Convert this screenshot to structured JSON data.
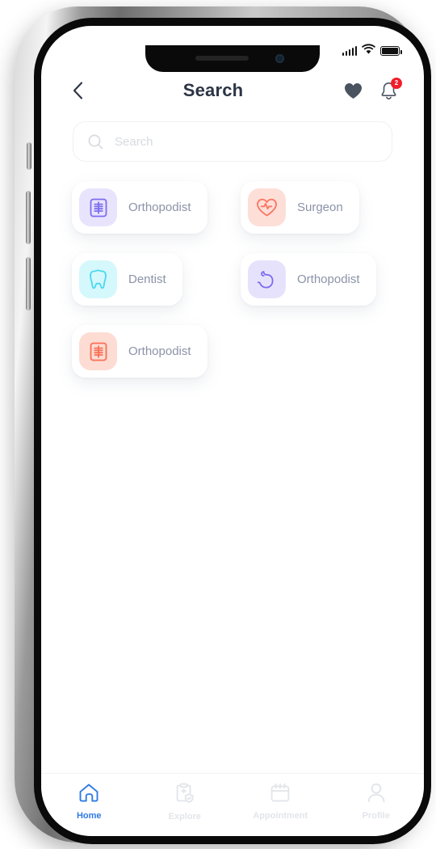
{
  "status_bar": {
    "signal_icon": "cellular-signal-icon",
    "wifi_icon": "wifi-icon",
    "battery_icon": "battery-full-icon"
  },
  "header": {
    "back_icon": "chevron-left-icon",
    "title": "Search",
    "favorite_icon": "heart-filled-icon",
    "notification_icon": "bell-icon",
    "notification_badge": "2"
  },
  "search": {
    "icon": "search-icon",
    "placeholder": "Search",
    "value": ""
  },
  "categories": [
    {
      "label": "Orthopodist",
      "icon": "xray-scan-icon",
      "icon_color": "#7b6df0",
      "bg_color": "#e9e4fd"
    },
    {
      "label": "Surgeon",
      "icon": "heart-pulse-icon",
      "icon_color": "#fa7561",
      "bg_color": "#fddfd8"
    },
    {
      "label": "Dentist",
      "icon": "tooth-icon",
      "icon_color": "#48d8ef",
      "bg_color": "#d5f8fc"
    },
    {
      "label": "Orthopodist",
      "icon": "stomach-icon",
      "icon_color": "#7b6df0",
      "bg_color": "#e7e2fb"
    },
    {
      "label": "Orthopodist",
      "icon": "xray-scan-icon",
      "icon_color": "#fa6f55",
      "bg_color": "#fddcd3"
    }
  ],
  "bottom_nav": {
    "active_color": "#2f7ae5",
    "inactive_color": "#e2e5ea",
    "items": [
      {
        "label": "Home",
        "icon": "home-icon",
        "active": true
      },
      {
        "label": "Explore",
        "icon": "clipboard-shield-icon",
        "active": false
      },
      {
        "label": "Appointment",
        "icon": "calendar-icon",
        "active": false
      },
      {
        "label": "Profile",
        "icon": "person-icon",
        "active": false
      }
    ]
  }
}
